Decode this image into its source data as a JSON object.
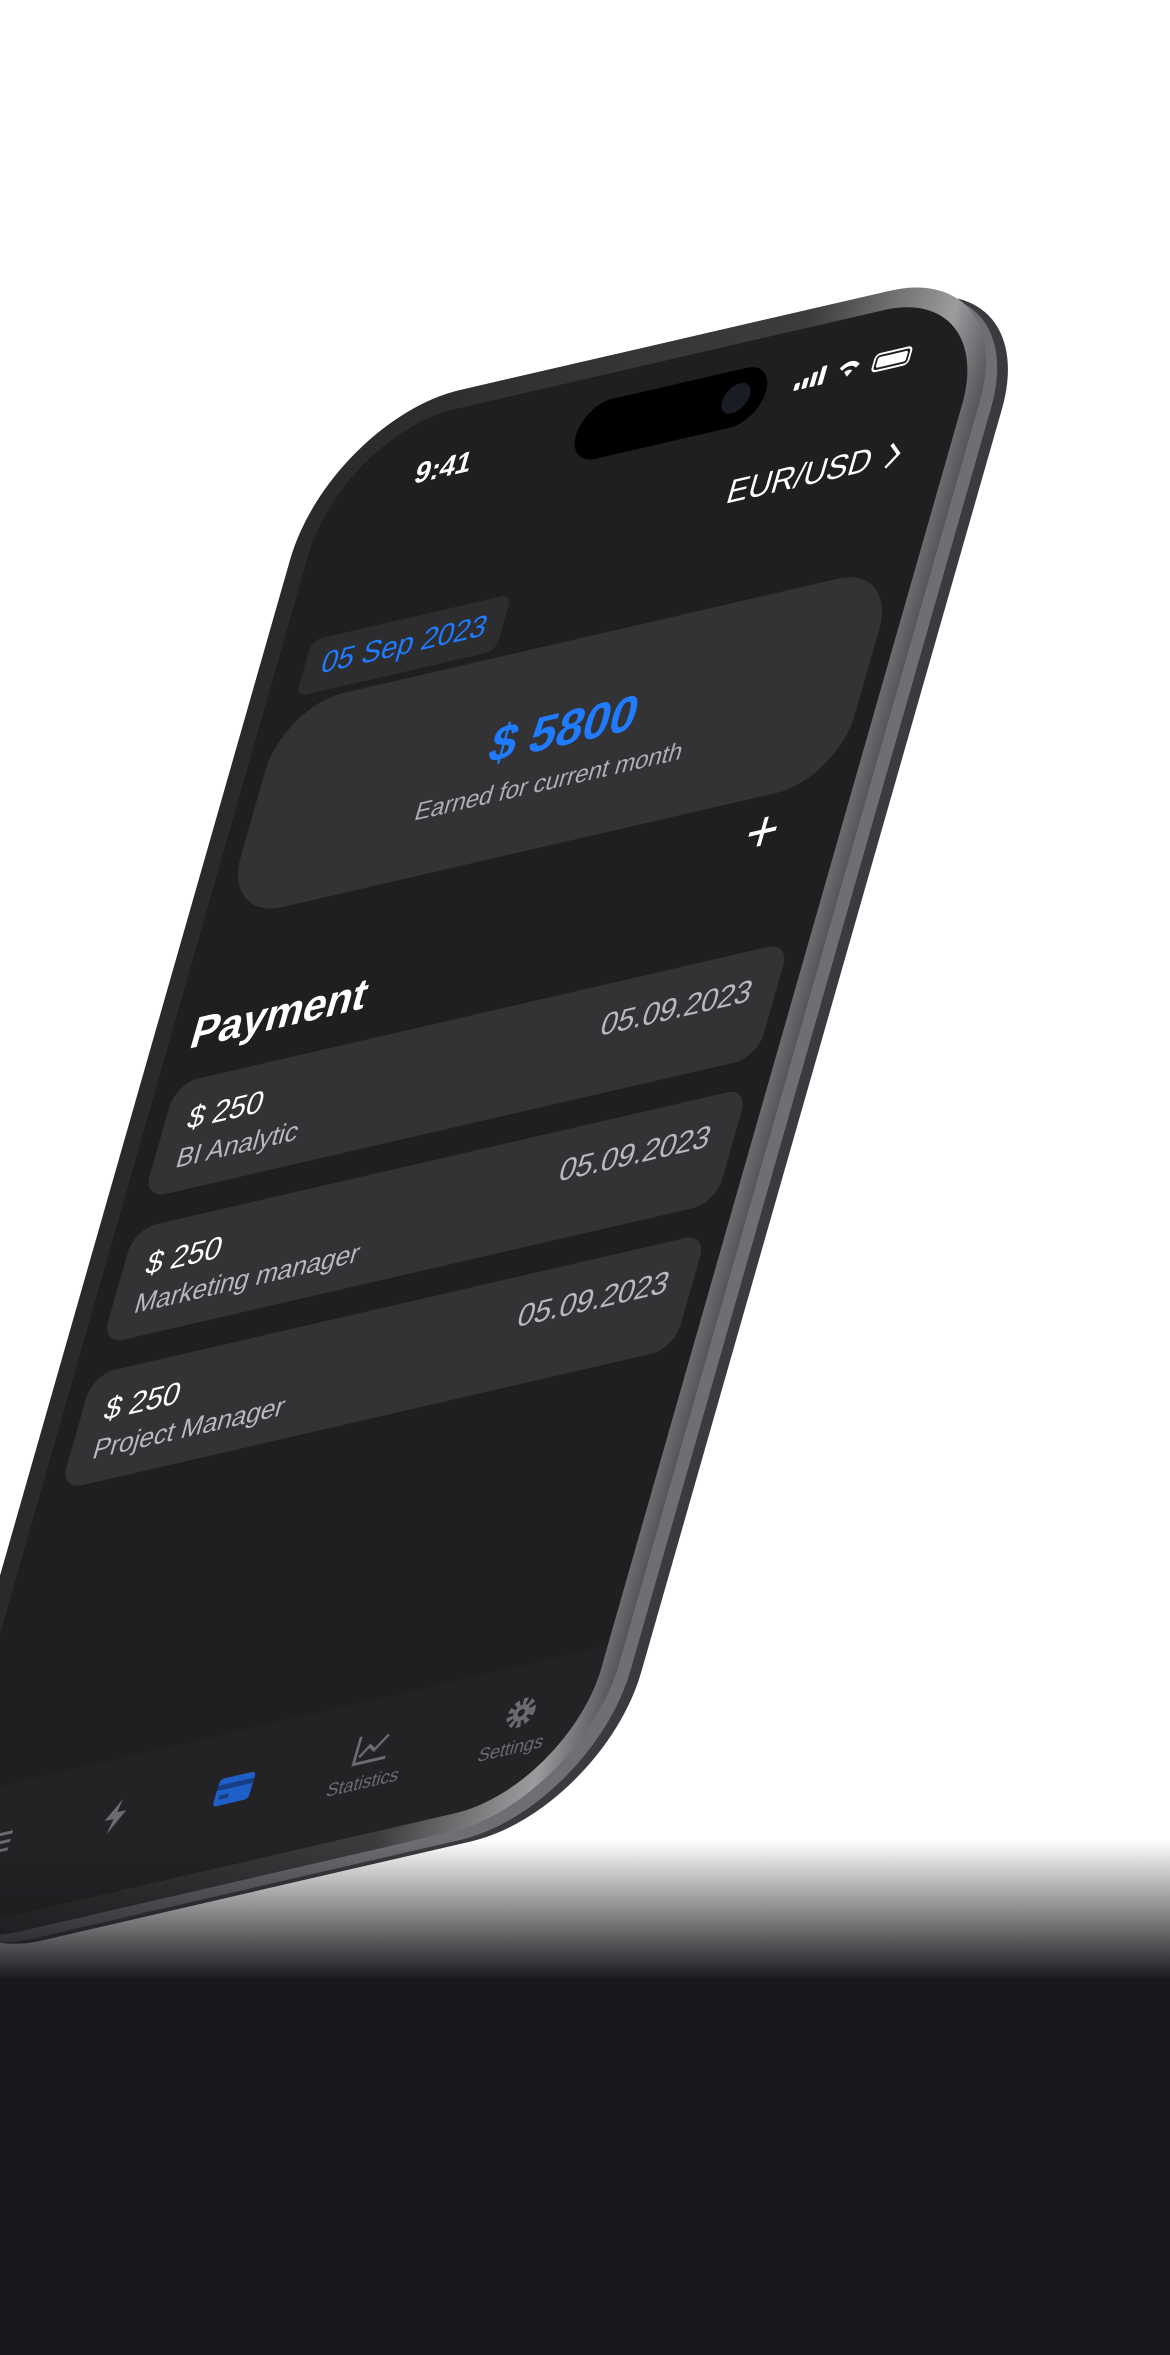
{
  "status_bar": {
    "time": "9:41"
  },
  "header": {
    "currency_pair": "EUR/USD"
  },
  "date_chip": "05 Sep 2023",
  "summary": {
    "amount": "$ 5800",
    "caption": "Earned for current month"
  },
  "section_title": "Payment",
  "payments": [
    {
      "amount": "$ 250",
      "title": "BI Analytic",
      "date": "05.09.2023"
    },
    {
      "amount": "$ 250",
      "title": "Marketing manager",
      "date": "05.09.2023"
    },
    {
      "amount": "$ 250",
      "title": "Project Manager",
      "date": "05.09.2023"
    }
  ],
  "tabs": [
    {
      "label": "",
      "icon": "list-icon"
    },
    {
      "label": "",
      "icon": "bolt-icon"
    },
    {
      "label": "",
      "icon": "card-icon",
      "active": true
    },
    {
      "label": "Statistics",
      "icon": "chart-icon"
    },
    {
      "label": "Settings",
      "icon": "gear-icon"
    }
  ],
  "colors": {
    "accent": "#1f7bff",
    "screen_bg": "#1f1f20",
    "card_bg": "#333335"
  }
}
